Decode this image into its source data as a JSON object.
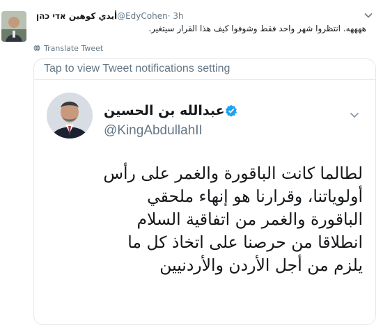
{
  "outer_tweet": {
    "display_name": "أيدي كوهين אדי כהן",
    "handle": "@EdyCohen",
    "time": "· 3h",
    "text": "ههههه. انتظروا شهر واحد فقط وشوفوا كيف هذا القرار سيتغير.",
    "translate_label": "Translate Tweet"
  },
  "quoted": {
    "notification_bar": "Tap to view Tweet notifications setting",
    "display_name": "عبدالله بن الحسين",
    "handle": "@KingAbdullahII",
    "body_lines": [
      "لطالما كانت الباقورة والغمر على رأس",
      "أولوياتنا، وقرارنا هو إنهاء ملحقي",
      "الباقورة والغمر من اتفاقية السلام",
      "انطلاقا من حرصنا على اتخاذ كل ما",
      "يلزم من أجل الأردن والأردنيين"
    ]
  },
  "icons": {
    "outer_avatar": "avatar",
    "outer_menu": "chevron-down-icon",
    "translate": "globe-icon",
    "verified": "verified-badge-icon",
    "quote_menu": "chevron-down-icon"
  },
  "colors": {
    "verified": "#1da1f2",
    "secondary_text": "#657786",
    "primary_text": "#14171a",
    "border": "#e1e8ed"
  }
}
